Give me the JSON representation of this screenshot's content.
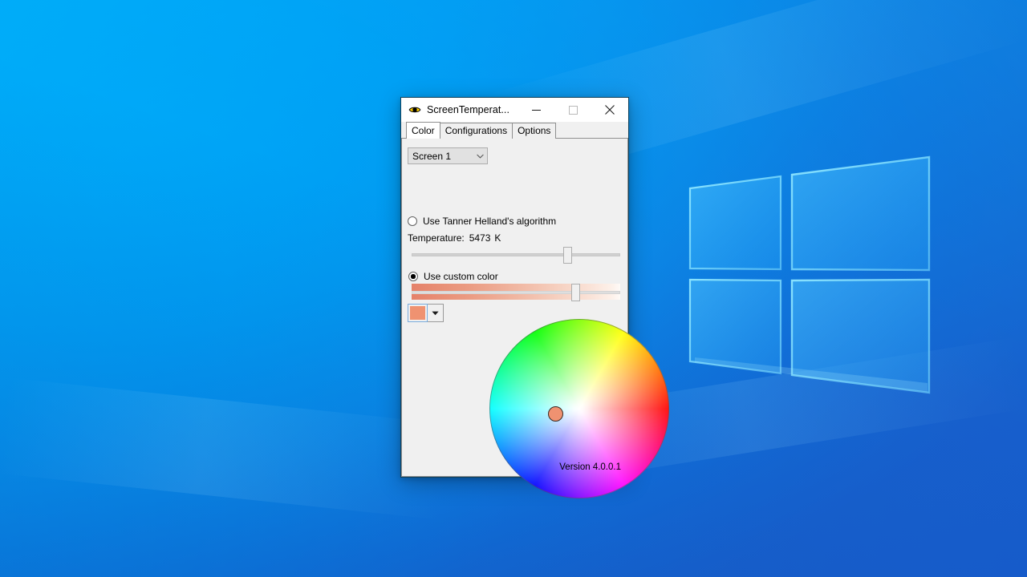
{
  "desktop": {
    "wallpaper_name": "windows-10-logo-wallpaper",
    "colors": {
      "light_blue": "#00a8f8",
      "mid_blue": "#0a8be8",
      "dark_blue": "#1560ce"
    }
  },
  "window": {
    "title": "ScreenTemperat...",
    "icon": "eye-icon",
    "accent_border": "#11425c",
    "controls": {
      "minimize": "minimize-icon",
      "maximize": "maximize-icon",
      "close": "close-icon"
    }
  },
  "tabs": [
    {
      "label": "Color",
      "active": true
    },
    {
      "label": "Configurations",
      "active": false
    },
    {
      "label": "Options",
      "active": false
    }
  ],
  "color_tab": {
    "screen_select": {
      "value": "Screen 1",
      "arrow_icon": "chevron-down-icon"
    },
    "tanner_option": {
      "label": "Use Tanner Helland's algorithm",
      "checked": false
    },
    "temperature": {
      "prefix": "Temperature:",
      "value": "5473",
      "unit": "K",
      "slider_percent": 76
    },
    "custom_color_option": {
      "label": "Use custom color",
      "checked": true
    },
    "intensity_slider": {
      "percent": 80
    },
    "swatch": {
      "color": "#ef9271",
      "dropdown_icon": "chevron-down-icon"
    },
    "color_wheel": {
      "marker_color": "#ef9271",
      "marker_x_percent": 37,
      "marker_y_percent": 53
    },
    "version": "Version 4.0.0.1"
  }
}
